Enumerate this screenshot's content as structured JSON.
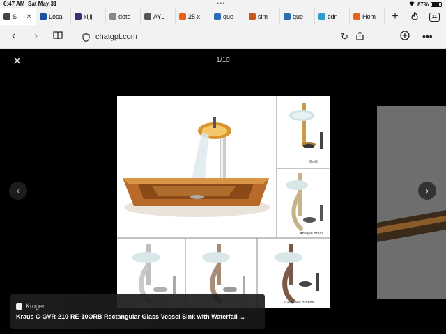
{
  "status": {
    "time": "6:47 AM",
    "date": "Sat May 31",
    "battery": "87%",
    "battery_level": 0.87
  },
  "tabs": [
    {
      "label": "S",
      "icon": "chatgpt-icon",
      "color": "#444444",
      "active": true
    },
    {
      "label": "Loca",
      "icon": "loc-icon",
      "color": "#1a4fa0"
    },
    {
      "label": "kijiji",
      "icon": "kijiji-icon",
      "color": "#373373"
    },
    {
      "label": "dote",
      "icon": "dote-icon",
      "color": "#888888"
    },
    {
      "label": "AYL",
      "icon": "ayl-icon",
      "color": "#555555"
    },
    {
      "label": "25 x",
      "icon": "orange-icon",
      "color": "#e8621a"
    },
    {
      "label": "que",
      "icon": "que-icon",
      "color": "#2a6db5"
    },
    {
      "label": "sim",
      "icon": "sim-icon",
      "color": "#c8571b"
    },
    {
      "label": "que",
      "icon": "que-icon",
      "color": "#2a6db5"
    },
    {
      "label": "cdn-",
      "icon": "cdn-icon",
      "color": "#2aa0c8"
    },
    {
      "label": "Hom",
      "icon": "home-icon",
      "color": "#e8621a"
    }
  ],
  "tab_count": "11",
  "address": {
    "url": "chatgpt.com"
  },
  "viewer": {
    "counter": "1/10"
  },
  "caption": {
    "source": "Kroger",
    "title": "Kraus C-GVR-210-RE-10ORB Rectangular Glass Vessel Sink with Waterfall ..."
  },
  "product_labels": {
    "gold": "Gold",
    "antique": "Antique Brass",
    "bronze": "Oil Rubbed Bronze"
  }
}
